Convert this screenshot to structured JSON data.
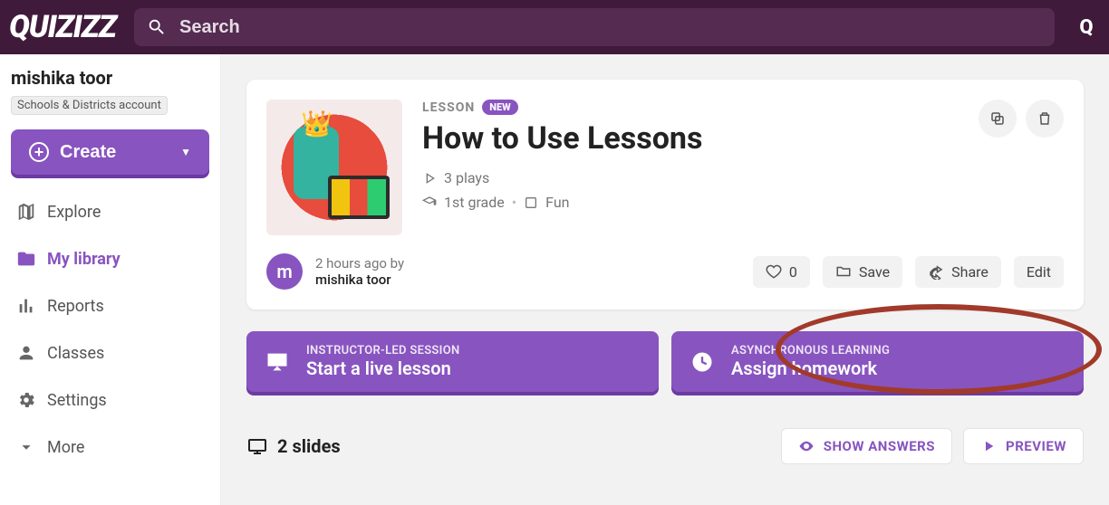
{
  "brand": "QUIZIZZ",
  "search": {
    "placeholder": "Search"
  },
  "user": {
    "name": "mishika toor",
    "account_type": "Schools & Districts account",
    "avatar_initial": "m"
  },
  "sidebar": {
    "create_label": "Create",
    "items": [
      {
        "label": "Explore",
        "icon": "map-icon",
        "active": false
      },
      {
        "label": "My library",
        "icon": "folder-open-icon",
        "active": true
      },
      {
        "label": "Reports",
        "icon": "chart-icon",
        "active": false
      },
      {
        "label": "Classes",
        "icon": "people-icon",
        "active": false
      },
      {
        "label": "Settings",
        "icon": "gear-icon",
        "active": false
      },
      {
        "label": "More",
        "icon": "chevron-down-icon",
        "active": false
      }
    ]
  },
  "lesson": {
    "kicker": "LESSON",
    "new_badge": "NEW",
    "title": "How to Use Lessons",
    "plays": "3 plays",
    "grade": "1st grade",
    "subject": "Fun",
    "created_ago": "2 hours ago by",
    "author": "mishika toor",
    "likes": "0",
    "actions": {
      "save": "Save",
      "share": "Share",
      "edit": "Edit"
    }
  },
  "cta": {
    "live": {
      "sub": "INSTRUCTOR-LED SESSION",
      "label": "Start a live lesson"
    },
    "homework": {
      "sub": "ASYNCHRONOUS LEARNING",
      "label": "Assign homework"
    }
  },
  "footer": {
    "slides": "2 slides",
    "show_answers": "SHOW ANSWERS",
    "preview": "PREVIEW"
  }
}
